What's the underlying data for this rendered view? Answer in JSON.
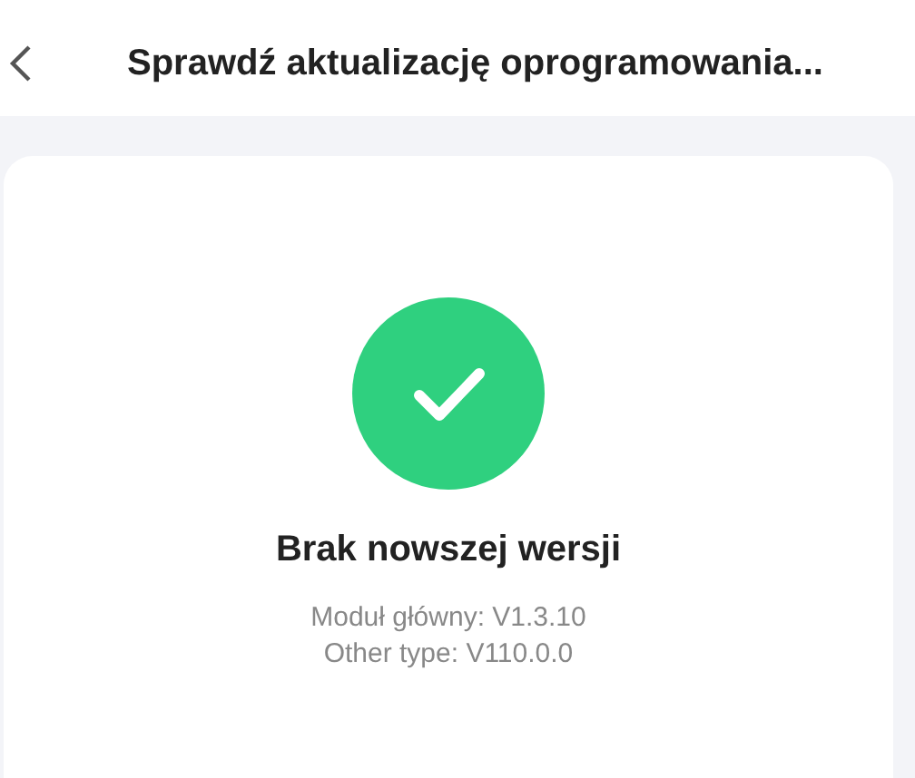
{
  "header": {
    "title": "Sprawdź aktualizację oprogramowania..."
  },
  "result": {
    "kind": "success",
    "title": "Brak nowszej wersji",
    "versions": [
      "Moduł główny: V1.3.10",
      "Other type: V110.0.0"
    ]
  }
}
